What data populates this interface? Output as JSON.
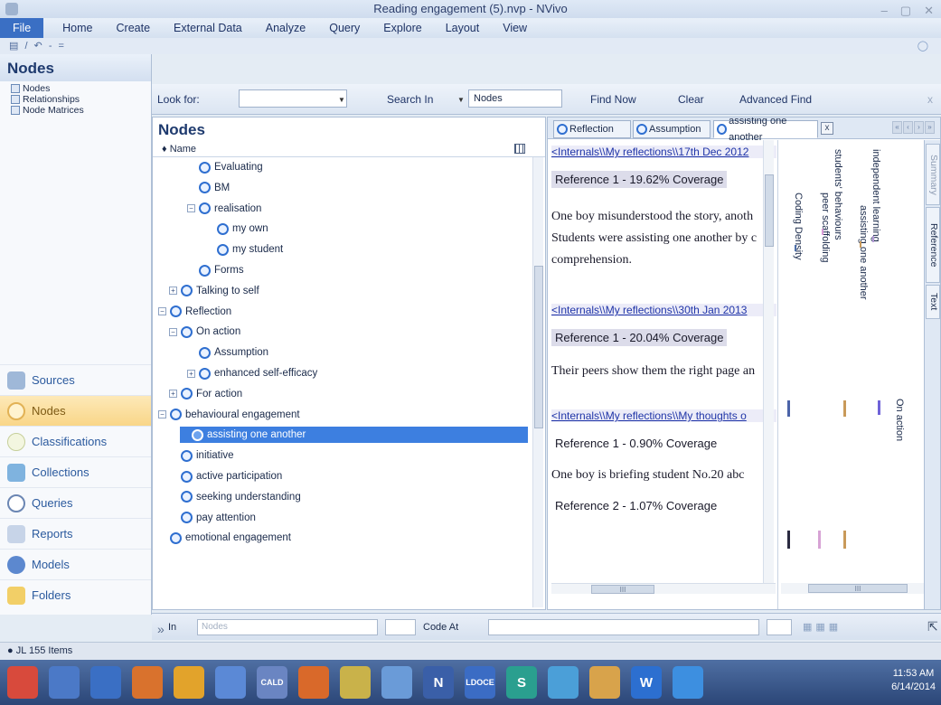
{
  "window": {
    "title": "Reading engagement (5).nvp - NVivo"
  },
  "menu": [
    "File",
    "Home",
    "Create",
    "External Data",
    "Analyze",
    "Query",
    "Explore",
    "Layout",
    "View"
  ],
  "qat": "▤ / ↶ - =",
  "left": {
    "header": "Nodes",
    "tree": [
      "Nodes",
      "Relationships",
      "Node Matrices"
    ],
    "nav": [
      "Sources",
      "Nodes",
      "Classifications",
      "Collections",
      "Queries",
      "Reports",
      "Models",
      "Folders"
    ]
  },
  "search": {
    "look_for_label": "Look for:",
    "look_for_value": "",
    "search_in_label": "Search In",
    "search_in_value": "Nodes",
    "find_now": "Find Now",
    "clear": "Clear",
    "advanced_find": "Advanced Find",
    "close": "x"
  },
  "nodes": {
    "header": "Nodes",
    "column": "Name",
    "rows": [
      {
        "label": "Evaluating",
        "indent": 2,
        "expander": "none"
      },
      {
        "label": "BM",
        "indent": 2,
        "expander": "none"
      },
      {
        "label": "realisation",
        "indent": 2,
        "expander": "minus"
      },
      {
        "label": "my own",
        "indent": 3,
        "expander": "none"
      },
      {
        "label": "my student",
        "indent": 3,
        "expander": "none"
      },
      {
        "label": "Forms",
        "indent": 2,
        "expander": "none"
      },
      {
        "label": "Talking to self",
        "indent": 1,
        "expander": "plus"
      },
      {
        "label": "Reflection",
        "indent": 0,
        "expander": "minus"
      },
      {
        "label": "On action",
        "indent": 1,
        "expander": "minus"
      },
      {
        "label": "Assumption",
        "indent": 2,
        "expander": "none"
      },
      {
        "label": "enhanced self-efficacy",
        "indent": 2,
        "expander": "plus"
      },
      {
        "label": "For action",
        "indent": 1,
        "expander": "plus"
      },
      {
        "label": "behavioural engagement",
        "indent": 0,
        "expander": "minus"
      },
      {
        "label": "assisting one another",
        "indent": 1,
        "expander": "none",
        "selected": true
      },
      {
        "label": "initiative",
        "indent": 1,
        "expander": "none"
      },
      {
        "label": "active participation",
        "indent": 1,
        "expander": "none"
      },
      {
        "label": "seeking understanding",
        "indent": 1,
        "expander": "none"
      },
      {
        "label": "pay attention",
        "indent": 1,
        "expander": "none"
      },
      {
        "label": "emotional engagement",
        "indent": 0,
        "expander": "none"
      }
    ]
  },
  "detail": {
    "tabs": [
      "Reflection",
      "Assumption",
      "assisting one another"
    ],
    "close_tab": "x",
    "refs": [
      {
        "link": "<Internals\\\\My reflections\\\\17th Dec 2012",
        "coverage": "Reference 1 - 19.62% Coverage",
        "text": [
          "One boy misunderstood the story, anoth",
          "Students were assisting one another by c",
          "comprehension."
        ]
      },
      {
        "link": "<Internals\\\\My reflections\\\\30th Jan 2013",
        "coverage": "Reference 1 - 20.04% Coverage",
        "text": [
          "Their peers show them the right page an"
        ]
      },
      {
        "link": "<Internals\\\\My reflections\\\\My thoughts o",
        "coverage": "Reference 1 - 0.90% Coverage",
        "text": [
          "One boy is briefing student No.20 abc"
        ]
      },
      {
        "link": "",
        "coverage": "Reference 2 - 1.07% Coverage",
        "text": []
      }
    ],
    "stripes": [
      "independent learning",
      "assisting one another",
      "students' behaviours",
      "peer scaffolding",
      "Coding Density",
      "On action"
    ],
    "side_tabs": [
      "Summary",
      "Reference",
      "Text"
    ],
    "hscroll_glyph": "III"
  },
  "codebar": {
    "in_label": "In",
    "in_value": "Nodes",
    "code_at_label": "Code At"
  },
  "status": {
    "user": "JL",
    "items": "155 Items"
  },
  "taskbar": {
    "apps": [
      "",
      "",
      "",
      "",
      "",
      "",
      "CALD",
      "",
      "",
      "",
      "N",
      "LDOCE",
      "S",
      "",
      "",
      "W",
      ""
    ],
    "time": "11:53 AM",
    "date": "6/14/2014"
  },
  "colors": {
    "accent": "#3d7fe0",
    "ribbon": "#dae4f1",
    "selected_nav": "#f9d688",
    "link": "#2035a8"
  }
}
